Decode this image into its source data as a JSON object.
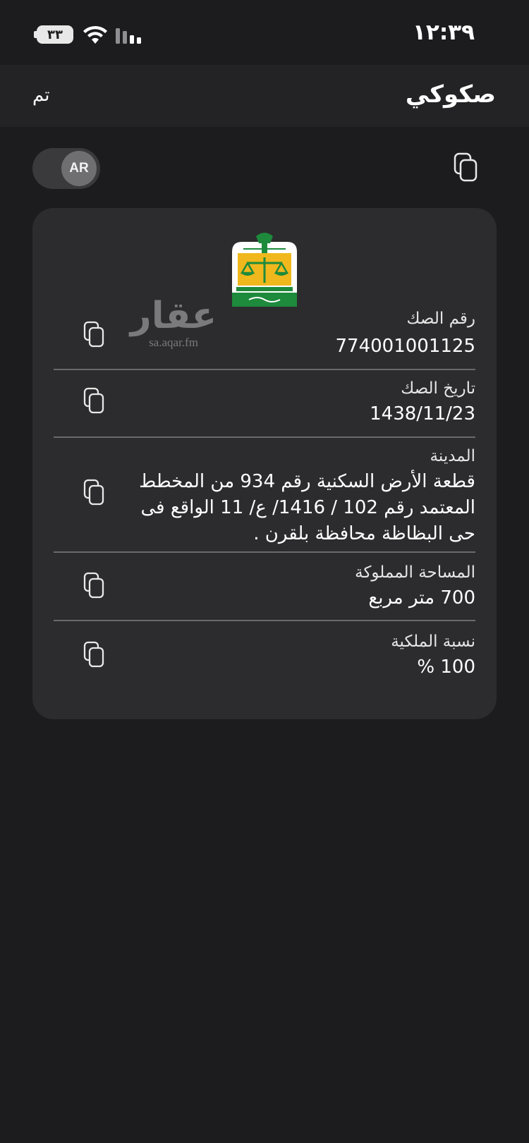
{
  "status_bar": {
    "time": "١٢:٣٩",
    "battery": "٣٣"
  },
  "nav": {
    "title": "صكوكي",
    "done_label": "تم"
  },
  "language_toggle": {
    "label": "AR"
  },
  "watermark": {
    "logo_text": "عقار",
    "site": "sa.aqar.fm"
  },
  "fields": [
    {
      "label": "رقم الصك",
      "value": "774001001125"
    },
    {
      "label": "تاريخ الصك",
      "value": "1438/11/23"
    },
    {
      "label": "المدينة",
      "value": "قطعة الأرض السكنية رقم 934 من المخطط المعتمد رقم 102 / 1416/ ع/ 11 الواقع فى حى البظاظة محافظة بلقرن ."
    },
    {
      "label": "المساحة المملوكة",
      "value": "700 متر مربع"
    },
    {
      "label": "نسبة الملكية",
      "value": "100 %"
    }
  ],
  "icons": {
    "copy": "copy-icon",
    "emblem": "ministry-of-justice-emblem",
    "wifi": "wifi-icon",
    "signal": "cellular-signal-icon",
    "battery": "battery-icon"
  },
  "colors": {
    "background": "#1c1c1e",
    "nav_background": "#232325",
    "card_background": "#2c2c2e",
    "emblem_green": "#1e8a3c",
    "emblem_gold": "#f0b81c"
  }
}
